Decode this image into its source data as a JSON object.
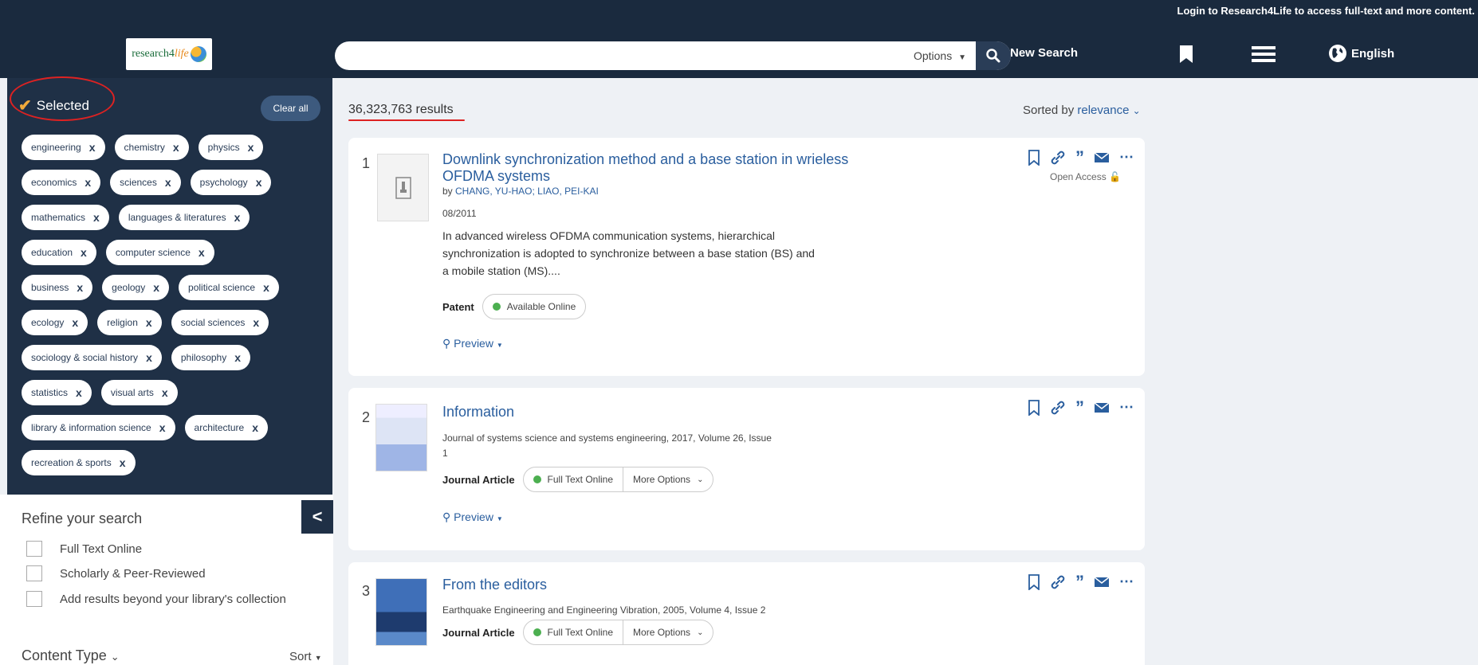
{
  "topbar": {
    "login_message": "Login to Research4Life to access full-text and more content.",
    "logo_text_a": "research4",
    "logo_text_b": "life",
    "search_value": "",
    "options_label": "Options",
    "new_search_label": "New Search",
    "language_label": "English"
  },
  "sidebar": {
    "selected_label": "Selected",
    "clear_all_label": "Clear all",
    "chip_rows": [
      [
        "engineering",
        "chemistry",
        "physics"
      ],
      [
        "economics",
        "sciences",
        "psychology"
      ],
      [
        "mathematics",
        "languages & literatures"
      ],
      [
        "education",
        "computer science"
      ],
      [
        "business",
        "geology",
        "political science"
      ],
      [
        "ecology",
        "religion",
        "social sciences"
      ],
      [
        "sociology & social history",
        "philosophy"
      ],
      [
        "statistics",
        "visual arts"
      ],
      [
        "library & information science",
        "architecture"
      ],
      [
        "recreation & sports"
      ]
    ],
    "chip_remove_glyph": "x",
    "refine_title": "Refine your search",
    "collapse_glyph": "<",
    "facets": [
      "Full Text Online",
      "Scholarly & Peer-Reviewed",
      "Add results beyond your library's collection"
    ],
    "content_type_label": "Content Type",
    "sort_label": "Sort"
  },
  "main": {
    "results_count": "36,323,763 results",
    "sorted_by_label": "Sorted by",
    "sorted_by_value": "relevance",
    "results": [
      {
        "number": "1",
        "title_line1": "Downlink synchronization method and a base station in wrieless",
        "title_line2": "OFDMA systems",
        "by": "by ",
        "authors": "CHANG, YU-HAO; LIAO, PEI-KAI",
        "date": "08/2011",
        "description": "In advanced wireless OFDMA communication systems, hierarchical synchronization is adopted to synchronize between a base station (BS) and a mobile station (MS)....",
        "type": "Patent",
        "availability": "Available Online",
        "preview": "Preview",
        "open_access": "Open Access"
      },
      {
        "number": "2",
        "title": "Information",
        "source_line1": "Journal of systems science and systems engineering, 2017, Volume 26, Issue",
        "source_line2": "1",
        "type": "Journal Article",
        "availability": "Full Text Online",
        "more_options": "More Options",
        "preview": "Preview"
      },
      {
        "number": "3",
        "title": "From the editors",
        "source": "Earthquake Engineering and Engineering Vibration, 2005, Volume 4, Issue 2",
        "type": "Journal Article",
        "availability": "Full Text Online",
        "more_options": "More Options"
      }
    ]
  },
  "colors": {
    "topbar": "#1a2a3e",
    "sidebar_selected": "#1f3046",
    "link": "#2a5e9e",
    "accent_check": "#f0a93b",
    "annotation": "#dd2222",
    "available_dot": "#4caf50"
  },
  "icons": [
    "search-icon",
    "bookmark-icon",
    "menu-icon",
    "globe-icon",
    "checkmark-icon",
    "close-icon",
    "chevron-left-icon",
    "chevron-down-icon",
    "link-icon",
    "quote-icon",
    "email-icon",
    "more-icon",
    "lock-icon",
    "preview-icon"
  ]
}
